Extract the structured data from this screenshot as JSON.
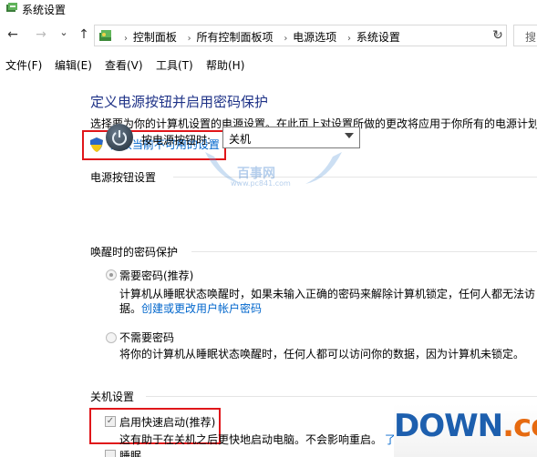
{
  "window": {
    "title": "系统设置"
  },
  "nav": {
    "back": "←",
    "forward": "→",
    "recent": "⌄",
    "up": "↑",
    "refresh": "↻"
  },
  "breadcrumb": [
    "控制面板",
    "所有控制面板项",
    "电源选项",
    "系统设置"
  ],
  "search": {
    "placeholder": "搜"
  },
  "menu": [
    {
      "label": "文件(F)"
    },
    {
      "label": "编辑(E)"
    },
    {
      "label": "查看(V)"
    },
    {
      "label": "工具(T)"
    },
    {
      "label": "帮助(H)"
    }
  ],
  "main": {
    "heading": "定义电源按钮并启用密码保护",
    "description": "选择要为你的计算机设置的电源设置。在此页上对设置所做的更改将应用于你所有的电源计划",
    "change_link": "更改当前不可用的设置"
  },
  "power_button": {
    "section_title": "电源按钮设置",
    "label": "按电源按钮时:",
    "selected": "关机"
  },
  "wake_password": {
    "section_title": "唤醒时的密码保护",
    "option1_label": "需要密码(推荐)",
    "option1_desc_line1": "计算机从睡眠状态唤醒时，如果未输入正确的密码来解除计算机锁定，任何人都无法访",
    "option1_desc_line2": "据。",
    "option1_link": "创建或更改用户帐户密码",
    "option2_label": "不需要密码",
    "option2_desc": "将你的计算机从睡眠状态唤醒时，任何人都可以访问你的数据，因为计算机未锁定。"
  },
  "shutdown": {
    "section_title": "关机设置",
    "fast_startup_label": "启用快速启动(推荐)",
    "fast_startup_desc": "这有助于在关机之后更快地启动电脑。不会影响重启。",
    "fast_startup_link": "了",
    "sleep_label": "睡眠"
  },
  "watermark": {
    "text": "百事网",
    "url": "www.pc841.com"
  },
  "logo": {
    "part1": "DOWN",
    "part2": ".cc"
  },
  "colors": {
    "heading": "#1e3287",
    "link": "#0066cc",
    "highlight_box": "#e0161a"
  }
}
